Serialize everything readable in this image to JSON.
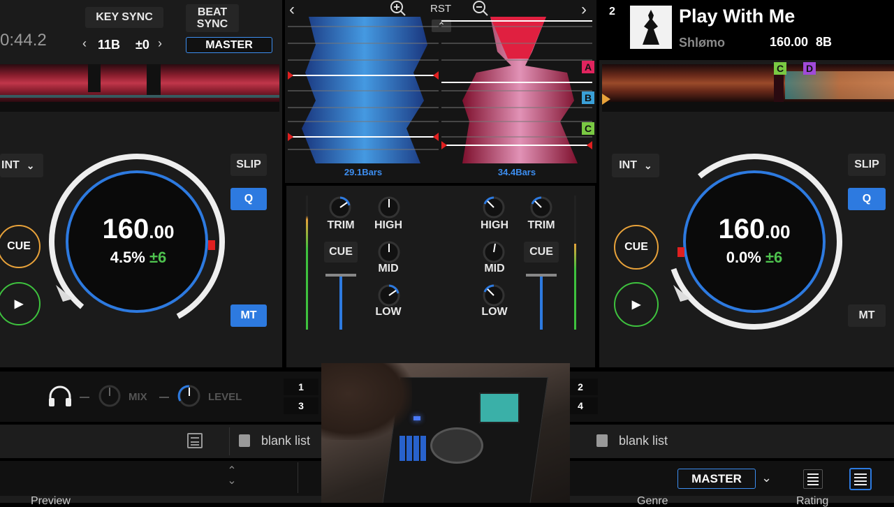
{
  "left": {
    "time": "0:44.2",
    "key_sync": "KEY SYNC",
    "beat_sync": "BEAT SYNC",
    "key_value": "11B",
    "key_offset": "±0",
    "master": "MASTER",
    "int": "INT",
    "slip": "SLIP",
    "q": "Q",
    "mt": "MT",
    "cue": "CUE",
    "bpm_main": "160",
    "bpm_dec": ".00",
    "pitch": "4.5%",
    "range": "±6",
    "bars": "29.1Bars"
  },
  "right": {
    "deck_number": "2",
    "title": "Play With Me",
    "artist": "Shlømo",
    "bpm_key": "160.00",
    "key": "8B",
    "int": "INT",
    "slip": "SLIP",
    "q": "Q",
    "mt": "MT",
    "cue": "CUE",
    "bpm_main": "160",
    "bpm_dec": ".00",
    "pitch": "0.0%",
    "range": "±6",
    "bars": "34.4Bars",
    "hotcues": [
      "C",
      "D"
    ]
  },
  "center": {
    "rst": "RST",
    "cue_markers": [
      "A",
      "B",
      "C"
    ]
  },
  "mixer": {
    "trim": "TRIM",
    "high": "HIGH",
    "mid": "MID",
    "low": "LOW",
    "cue": "CUE",
    "mix": "MIX",
    "level": "LEVEL",
    "deck_buttons": [
      "1",
      "3",
      "2",
      "4"
    ]
  },
  "browser": {
    "left_list": "blank list",
    "right_list": "blank list",
    "master": "MASTER",
    "columns": [
      "Preview",
      "Genre",
      "Rating"
    ]
  },
  "colors": {
    "accent_blue": "#2d7ae0",
    "cue_orange": "#e8a23a",
    "play_green": "#3ec23e",
    "hotcue_red": "#e0245e",
    "hotcue_blue": "#3aa0d8",
    "hotcue_green": "#7ac943",
    "hotcue_purple": "#a04ad8"
  }
}
